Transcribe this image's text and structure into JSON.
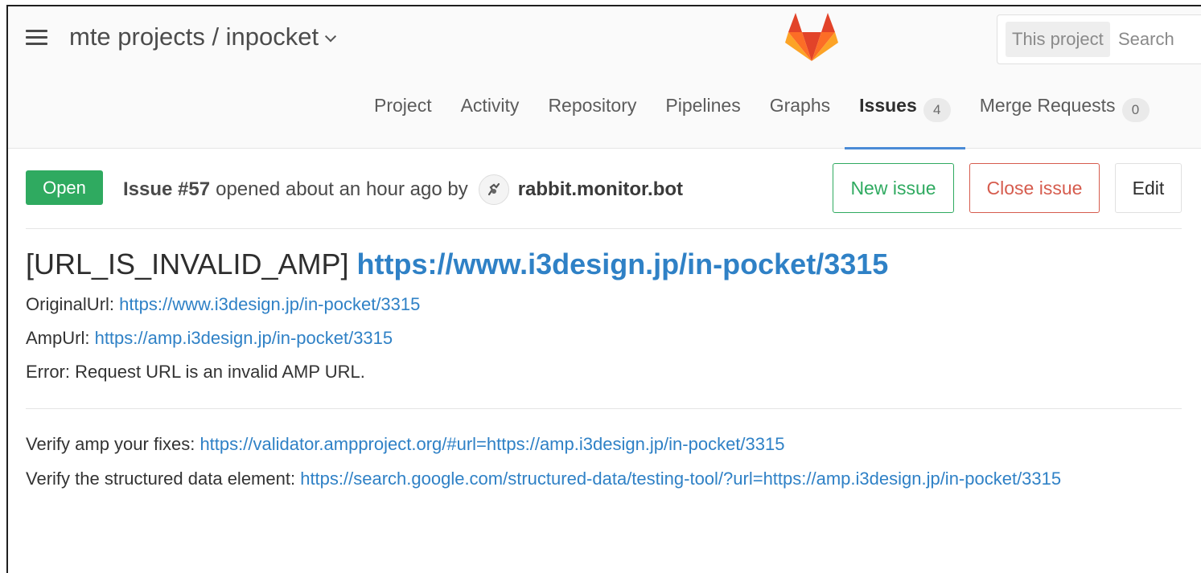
{
  "header": {
    "breadcrumb": "mte projects / inpocket",
    "search": {
      "scope": "This project",
      "placeholder": "Search"
    },
    "nav": [
      {
        "label": "Project"
      },
      {
        "label": "Activity"
      },
      {
        "label": "Repository"
      },
      {
        "label": "Pipelines"
      },
      {
        "label": "Graphs"
      },
      {
        "label": "Issues",
        "count": "4",
        "active": true
      },
      {
        "label": "Merge Requests",
        "count": "0"
      }
    ]
  },
  "issue": {
    "status": "Open",
    "ref": "Issue #57",
    "opened_text": "opened about an hour ago by",
    "author": "rabbit.monitor.bot",
    "buttons": {
      "new": "New issue",
      "close": "Close issue",
      "edit": "Edit"
    },
    "title_prefix": "[URL_IS_INVALID_AMP]",
    "title_link": "https://www.i3design.jp/in-pocket/3315",
    "description": {
      "original_label": "OriginalUrl:",
      "original_url": "https://www.i3design.jp/in-pocket/3315",
      "amp_label": "AmpUrl:",
      "amp_url": "https://amp.i3design.jp/in-pocket/3315",
      "error": "Error: Request URL is an invalid AMP URL.",
      "verify_amp_label": "Verify amp your fixes:",
      "verify_amp_url": "https://validator.ampproject.org/#url=https://amp.i3design.jp/in-pocket/3315",
      "verify_structured_label": "Verify the structured data element:",
      "verify_structured_url": "https://search.google.com/structured-data/testing-tool/?url=https://amp.i3design.jp/in-pocket/3315"
    }
  },
  "colors": {
    "accent_blue": "#2f81c6",
    "open_green": "#2faa60",
    "close_red": "#d65c4e",
    "active_tab_underline": "#4a8bd6"
  }
}
